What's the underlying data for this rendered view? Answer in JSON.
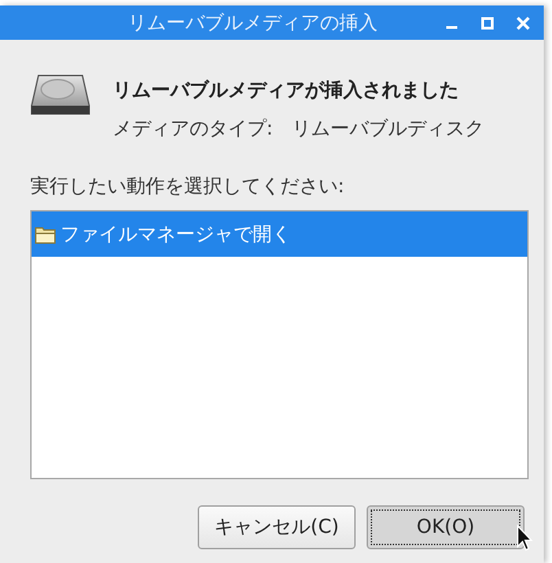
{
  "window": {
    "title": "リムーバブルメディアの挿入"
  },
  "heading": "リムーバブルメディアが挿入されました",
  "media_type": {
    "label": "メディアのタイプ:",
    "value": "リムーバブルディスク"
  },
  "prompt": "実行したい動作を選択してください:",
  "actions": [
    {
      "label": "ファイルマネージャで開く",
      "selected": true
    }
  ],
  "buttons": [
    {
      "label": "キャンセル(C)",
      "focused": false
    },
    {
      "label": "OK(O)",
      "focused": true
    }
  ]
}
